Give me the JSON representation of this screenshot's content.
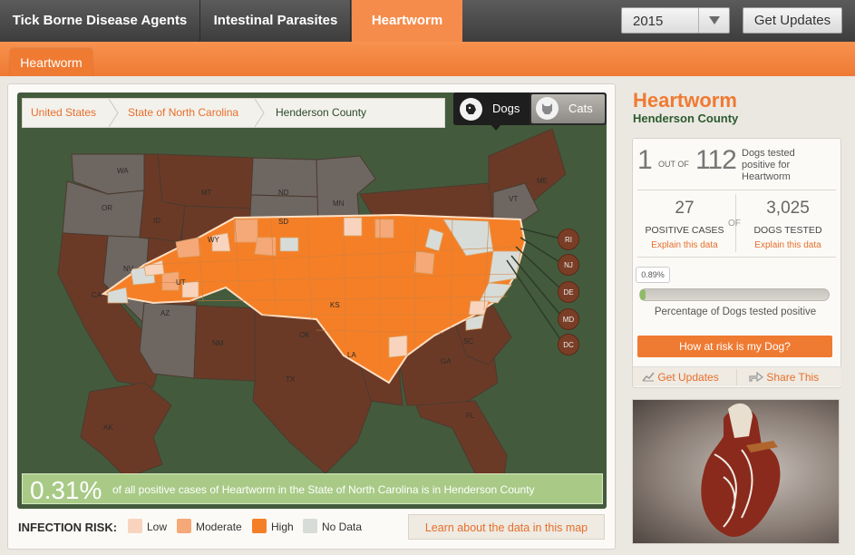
{
  "topnav": {
    "tabs": [
      {
        "label": "Tick Borne Disease Agents",
        "active": false
      },
      {
        "label": "Intestinal Parasites",
        "active": false
      },
      {
        "label": "Heartworm",
        "active": true
      }
    ],
    "year_select": {
      "value": "2015"
    },
    "get_updates_label": "Get Updates"
  },
  "subnav": {
    "active_tab": "Heartworm"
  },
  "breadcrumb": [
    "United States",
    "State of North Carolina",
    "Henderson County"
  ],
  "species_toggle": {
    "dogs": "Dogs",
    "cats": "Cats",
    "selected": "Dogs"
  },
  "map": {
    "state_labels": [
      "WA",
      "OR",
      "CA",
      "NV",
      "ID",
      "MT",
      "WY",
      "UT",
      "AZ",
      "NM",
      "ND",
      "SD",
      "MN",
      "TX",
      "OK",
      "KS",
      "LA",
      "FL",
      "GA",
      "SC",
      "ME",
      "VT",
      "AK"
    ],
    "small_states": [
      "RI",
      "NJ",
      "DE",
      "MD",
      "DC"
    ],
    "colors": {
      "low": "#f8d4be",
      "moderate": "#f5a878",
      "high": "#f57f26",
      "no_data": "#d8dcd8",
      "state_dark": "#6b3a26",
      "state_gray": "#6e6660",
      "water_bg": "#445a3c"
    }
  },
  "stat_banner": {
    "percent": "0.31%",
    "text": "of all positive cases of Heartworm in the State of North Carolina is in Henderson County"
  },
  "legend": {
    "title": "INFECTION RISK:",
    "items": [
      {
        "label": "Low",
        "color": "#f8d4be"
      },
      {
        "label": "Moderate",
        "color": "#f5a878"
      },
      {
        "label": "High",
        "color": "#f57f26"
      },
      {
        "label": "No Data",
        "color": "#d8dcd8"
      }
    ]
  },
  "learn_button": "Learn about the data in this map",
  "sidebar": {
    "title": "Heartworm",
    "subtitle": "Henderson County",
    "ratio_num": "1",
    "ratio_outof": "OUT OF",
    "ratio_den": "112",
    "ratio_text": "Dogs tested positive for Heartworm",
    "positive_cases": "27",
    "positive_cases_label": "POSITIVE CASES",
    "of_label": "OF",
    "dogs_tested": "3,025",
    "dogs_tested_label": "DOGS TESTED",
    "explain_label": "Explain this data",
    "percent_positive": "0.89%",
    "percent_positive_value": 0.89,
    "percent_label": "Percentage of Dogs tested positive",
    "risk_button": "How at risk is my Dog?",
    "get_updates": "Get Updates",
    "share_this": "Share This"
  }
}
